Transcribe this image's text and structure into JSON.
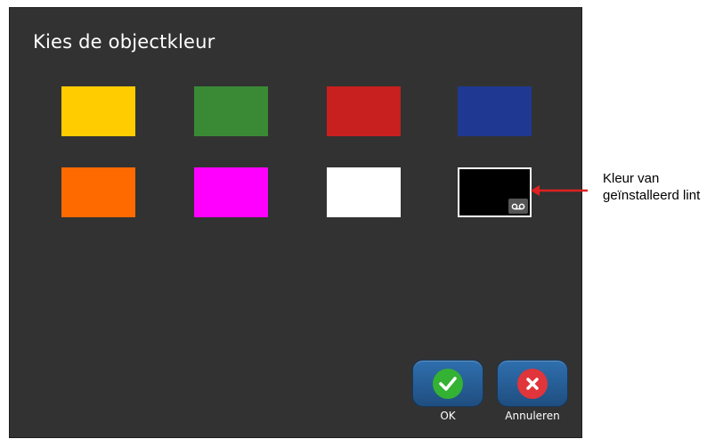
{
  "dialog": {
    "title": "Kies de objectkleur"
  },
  "swatches": [
    {
      "name": "yellow",
      "color": "#FFCC00"
    },
    {
      "name": "green",
      "color": "#3A8A35"
    },
    {
      "name": "red",
      "color": "#C8201E"
    },
    {
      "name": "blue",
      "color": "#1F3891"
    },
    {
      "name": "orange",
      "color": "#FF6A00"
    },
    {
      "name": "magenta",
      "color": "#FF00FF"
    },
    {
      "name": "white",
      "color": "#FFFFFF"
    },
    {
      "name": "black",
      "color": "#000000",
      "selected": true,
      "icon": "ribbon-cassette-icon"
    }
  ],
  "buttons": {
    "ok_label": "OK",
    "cancel_label": "Annuleren"
  },
  "callout": {
    "line1": "Kleur van",
    "line2": "geïnstalleerd lint"
  },
  "colors": {
    "screen_bg": "#323232",
    "button_bg": "#2A64A0",
    "ok_green": "#34B233",
    "cancel_red": "#E0353A",
    "arrow_red": "#E02020"
  }
}
